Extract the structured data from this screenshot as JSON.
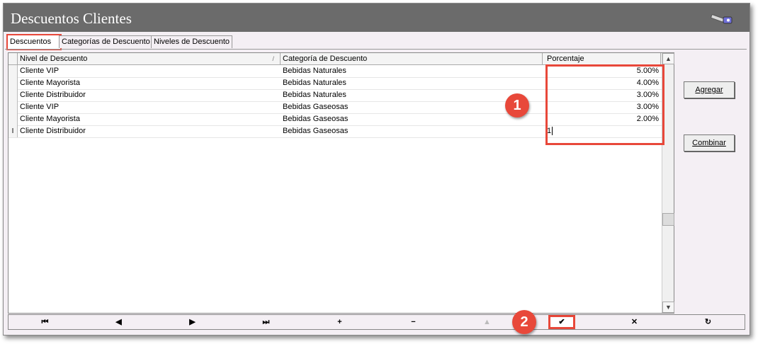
{
  "window": {
    "title": "Descuentos Clientes",
    "icon": "key-icon"
  },
  "tabs": [
    {
      "label": "Descuentos",
      "active": true
    },
    {
      "label": "Categorías de Descuento",
      "active": false
    },
    {
      "label": "Niveles de Descuento",
      "active": false
    }
  ],
  "grid": {
    "columns": [
      "Nivel de Descuento",
      "Categoría de Descuento",
      "Porcentaje"
    ],
    "sort_indicator": "/",
    "rows": [
      {
        "nivel": "Cliente VIP",
        "categoria": "Bebidas Naturales",
        "porcentaje": "5.00%"
      },
      {
        "nivel": "Cliente Mayorista",
        "categoria": "Bebidas Naturales",
        "porcentaje": "4.00%"
      },
      {
        "nivel": "Cliente Distribuidor",
        "categoria": "Bebidas Naturales",
        "porcentaje": "3.00%"
      },
      {
        "nivel": "Cliente VIP",
        "categoria": "Bebidas Gaseosas",
        "porcentaje": "3.00%"
      },
      {
        "nivel": "Cliente Mayorista",
        "categoria": "Bebidas Gaseosas",
        "porcentaje": "2.00%"
      },
      {
        "nivel": "Cliente Distribuidor",
        "categoria": "Bebidas Gaseosas",
        "porcentaje": "1",
        "editing": true,
        "indicator": "I"
      }
    ]
  },
  "buttons": {
    "agregar": "Agregar",
    "combinar": "Combinar"
  },
  "navigator": [
    {
      "name": "first",
      "glyph": "⏮",
      "enabled": true
    },
    {
      "name": "prior",
      "glyph": "◀",
      "enabled": true
    },
    {
      "name": "next",
      "glyph": "▶",
      "enabled": true
    },
    {
      "name": "last",
      "glyph": "⏭",
      "enabled": true
    },
    {
      "name": "insert",
      "glyph": "+",
      "enabled": true
    },
    {
      "name": "delete",
      "glyph": "−",
      "enabled": true
    },
    {
      "name": "edit",
      "glyph": "▲",
      "enabled": false
    },
    {
      "name": "post",
      "glyph": "✔",
      "enabled": true,
      "highlight": true
    },
    {
      "name": "cancel",
      "glyph": "✕",
      "enabled": true
    },
    {
      "name": "refresh",
      "glyph": "↻",
      "enabled": true
    }
  ],
  "annotations": {
    "badge1": "1",
    "badge2": "2"
  },
  "colors": {
    "accent": "#e8483a",
    "titlebar": "#6b6b6b"
  }
}
